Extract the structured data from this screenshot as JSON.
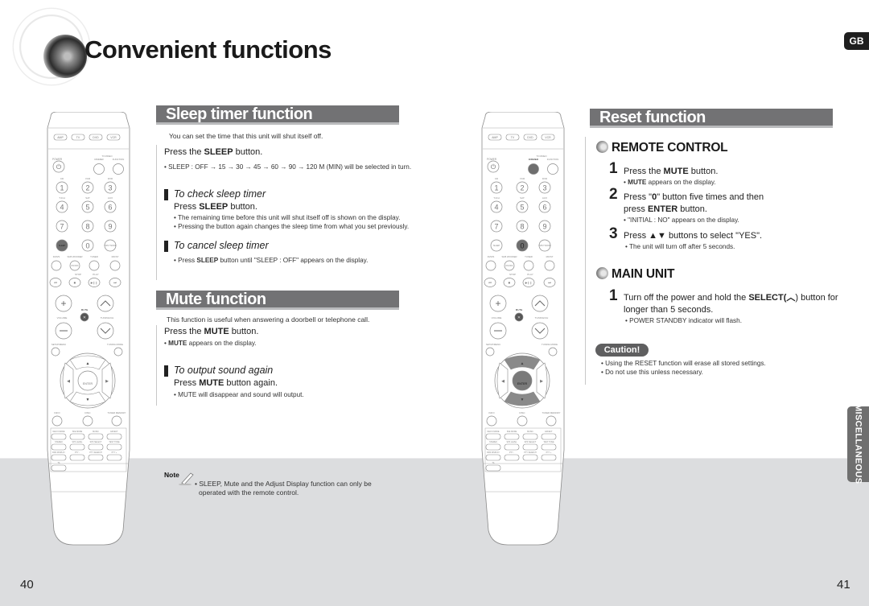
{
  "header": {
    "title": "Convenient functions",
    "language_badge": "GB",
    "side_tab": "MISCELLANEOUS"
  },
  "sleep": {
    "title": "Sleep timer function",
    "intro": "You can set the time that this unit will shut itself off.",
    "step": {
      "pre": "Press the ",
      "bold": "SLEEP",
      "post": " button."
    },
    "sequence": "• SLEEP : OFF → 15 → 30 → 45 → 60 → 90 → 120 M (MIN) will be selected in turn.",
    "check": {
      "heading": "To check sleep timer",
      "step": {
        "pre": "Press ",
        "bold": "SLEEP",
        "post": " button."
      },
      "bullets": [
        "• The remaining time before this unit will shut itself off is shown on the display.",
        "• Pressing the button again changes the sleep time from what you set previously."
      ]
    },
    "cancel": {
      "heading": "To cancel sleep timer",
      "bullet": {
        "pre": "• Press ",
        "bold": "SLEEP",
        "post": " button until \"SLEEP : OFF\" appears on the display."
      }
    }
  },
  "mute": {
    "title": "Mute function",
    "intro": "This function is useful when answering a doorbell or telephone call.",
    "step": {
      "pre": "Press the ",
      "bold": "MUTE",
      "post": " button."
    },
    "bullet": {
      "pre": "• ",
      "bold": "MUTE",
      "post": " appears on the display."
    },
    "output": {
      "heading": "To output sound again",
      "step": {
        "pre": "Press ",
        "bold": "MUTE",
        "post": " button again."
      },
      "bullet": "• MUTE will disappear and sound will output."
    }
  },
  "note": {
    "label": "Note",
    "lines": [
      "• SLEEP, Mute and the Adjust Display function can only be",
      "operated with the remote control."
    ]
  },
  "reset": {
    "title": "Reset function",
    "remote": {
      "heading": "REMOTE CONTROL",
      "steps": [
        {
          "num": "1",
          "pre": "Press the ",
          "bold": "MUTE",
          "post": " button.",
          "bullet_bold": "MUTE",
          "bullet": " appears on the display."
        },
        {
          "num": "2",
          "line1_pre": "Press \"",
          "line1_bold": "0",
          "line1_post": "\" button five times and then",
          "line2_pre": "press ",
          "line2_bold": "ENTER",
          "line2_post": " button.",
          "bullet": "• \"INITIAL : NO\" appears on the display."
        },
        {
          "num": "3",
          "text": "Press ▲▼ buttons to select  \"YES\".",
          "bullet": "• The unit will turn off after 5 seconds."
        }
      ]
    },
    "main": {
      "heading": "MAIN UNIT",
      "step": {
        "num": "1",
        "pre": "Turn off the power and hold the ",
        "bold": "SELECT(",
        "post": ") button for",
        "line2": "longer than 5 seconds.",
        "bullet": "• POWER STANDBY indicator will flash."
      }
    },
    "caution": {
      "label": "Caution!",
      "bullets": [
        "• Using the RESET function will erase all stored settings.",
        "• Do not use this unless necessary."
      ]
    }
  },
  "remote_labels": {
    "modes": [
      "AMP",
      "TV",
      "DVD",
      "VCR"
    ],
    "power": "POWER",
    "dimmer": "DIMMER",
    "function": "FUNCTION",
    "tv_video": "TV/VIDEO",
    "numbers": [
      "1",
      "2",
      "3",
      "4",
      "5",
      "6",
      "7",
      "8",
      "9",
      "0"
    ],
    "sources": [
      "CD",
      "VCR",
      "DVD",
      "T.ICH",
      "SAT",
      "AUX"
    ],
    "sleep": "SLEEP",
    "input_mode": "INPUT MODE",
    "row_labels": [
      "DVD/S",
      "SUB WOOFER",
      "TUNER",
      "MO/ST"
    ],
    "on_off": "ON/OFF",
    "stop": "STOP",
    "play": "PLAY",
    "mute": "MUTE",
    "volume": "VOLUME",
    "tuning_ch": "TUNING/CH",
    "setup_menu": "SETUP/MENU",
    "tuning_mode": "TUNING MODE",
    "enter": "ENTER",
    "info": "INFO",
    "disc": "DISC",
    "tuner_memory": "TUNER MEMORY",
    "bottom_rows": [
      [
        "NEO:6 MODE",
        "SFE MODE",
        "MUSIC",
        "EFFECT"
      ],
      [
        "STEREO",
        "SPK LEVEL",
        "SPK SELECT",
        "TEST TONE"
      ],
      [
        "RDS DISPLAY",
        "PTY -",
        "PTY SEARCH",
        "PTY +"
      ],
      [
        "TA"
      ]
    ]
  },
  "page_numbers": {
    "left": "40",
    "right": "41"
  },
  "colors": {
    "section_bar": "#727274",
    "highlight": "#6e6e6e",
    "footer_band": "#dcdddf"
  }
}
